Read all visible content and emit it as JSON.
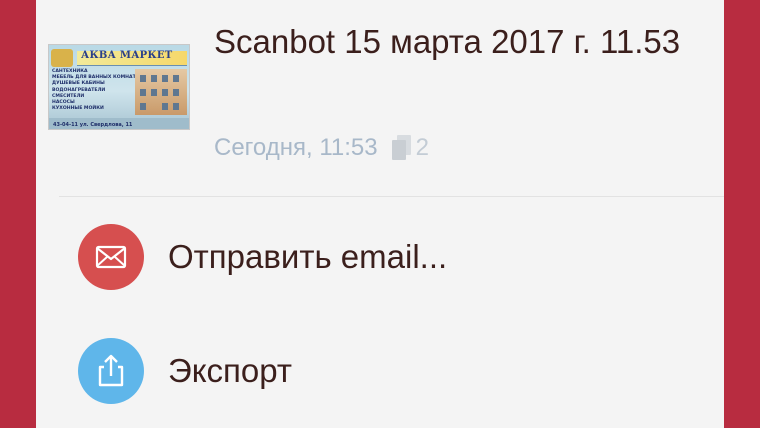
{
  "document": {
    "title": "Scanbot 15 марта 2017 г. 11.53",
    "date": "Сегодня, 11:53",
    "page_count": "2",
    "thumbnail": {
      "sign_title": "АКВА МАРКЕТ",
      "lines": [
        "САНТЕХНИКА",
        "МЕБЕЛЬ ДЛЯ ВАННЫХ КОМНАТ",
        "ДУШЕВЫЕ КАБИНЫ",
        "ВОДОНАГРЕВАТЕЛИ",
        "СМЕСИТЕЛИ",
        "НАСОСЫ",
        "КУХОННЫЕ МОЙКИ"
      ],
      "footer": "43-04-11 ул. Свердлова, 11"
    }
  },
  "actions": [
    {
      "label": "Отправить email...",
      "icon": "envelope-icon",
      "color": "#d64f4f"
    },
    {
      "label": "Экспорт",
      "icon": "share-export-icon",
      "color": "#5fb6ea"
    }
  ],
  "colors": {
    "background": "#b82c40",
    "sheet": "#f4f4f4",
    "text": "#3b1f1c",
    "meta": "#a8b8c9"
  }
}
